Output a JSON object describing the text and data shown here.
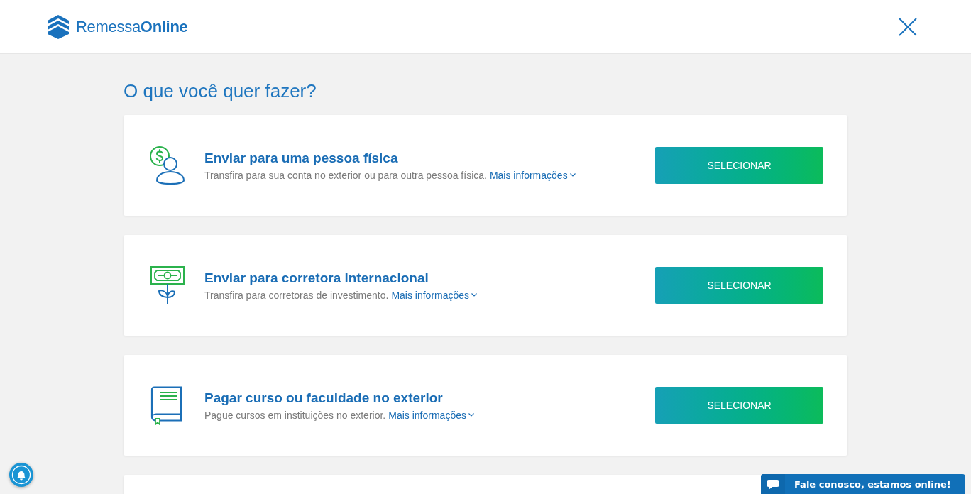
{
  "header": {
    "logo": "Remessa**Online**"
  },
  "heading": "O que você quer fazer?",
  "options": [
    {
      "kind": "person-money",
      "title": "Enviar para uma pessoa física",
      "description": "Transfira para sua conta no exterior ou para outra pessoa física.",
      "link": "Mais informações",
      "button": "SELECIONAR"
    },
    {
      "kind": "plant-banknote",
      "title": "Enviar para corretora internacional",
      "description": "Transfira para corretoras de investimento.",
      "link": "Mais informações",
      "button": "SELECIONAR"
    },
    {
      "kind": "book",
      "title": "Pagar curso ou faculdade no exterior",
      "description": "Pague cursos em instituições no exterior.",
      "link": "Mais informações",
      "button": "SELECIONAR"
    }
  ],
  "partial_card_below": true,
  "chat_widget": {
    "label": "Fale conosco, estamos online!"
  }
}
